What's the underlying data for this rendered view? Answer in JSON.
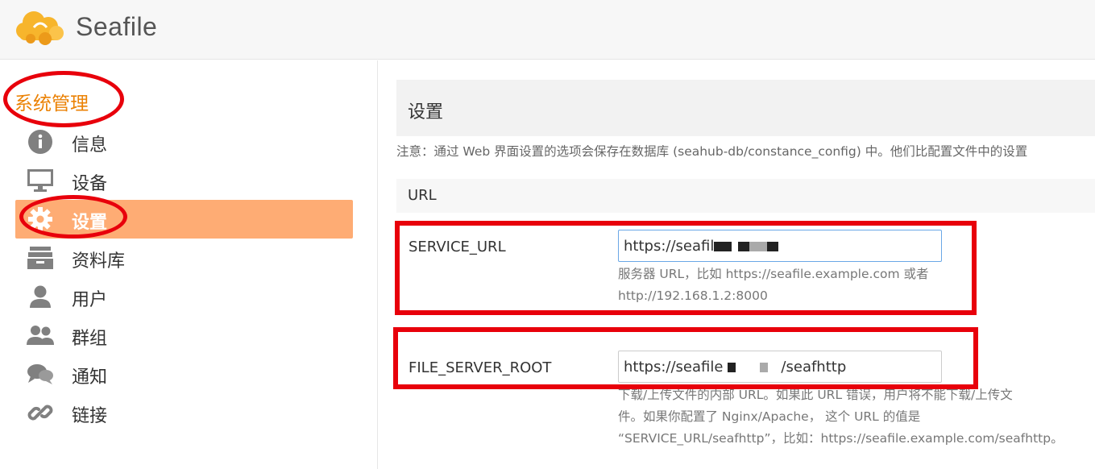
{
  "app": {
    "name": "Seafile"
  },
  "sidebar": {
    "title": "系统管理",
    "items": [
      {
        "label": "信息",
        "icon": "info-icon"
      },
      {
        "label": "设备",
        "icon": "monitor-icon"
      },
      {
        "label": "设置",
        "icon": "gear-icon",
        "active": true
      },
      {
        "label": "资料库",
        "icon": "library-icon"
      },
      {
        "label": "用户",
        "icon": "user-icon"
      },
      {
        "label": "群组",
        "icon": "group-icon"
      },
      {
        "label": "通知",
        "icon": "chat-icon"
      },
      {
        "label": "链接",
        "icon": "link-icon"
      }
    ]
  },
  "main": {
    "title": "设置",
    "notice": "注意：通过 Web 界面设置的选项会保存在数据库 (seahub-db/constance_config) 中。他们比配置文件中的设置",
    "section": "URL",
    "fields": [
      {
        "name": "SERVICE_URL",
        "value_prefix": "https://seafil",
        "help": "服务器 URL，比如 https://seafile.example.com 或者 http://192.168.1.2:8000"
      },
      {
        "name": "FILE_SERVER_ROOT",
        "value_prefix": "https://seafile",
        "value_suffix": "/seafhttp",
        "help_line1": "下载/上传文件的内部 URL。如果此 URL 错误，用户将不能下载/上传文",
        "help_line2": "件。如果你配置了 Nginx/Apache， 这个 URL 的值是",
        "help_line3": "“SERVICE_URL/seafhttp”，比如：https://seafile.example.com/seafhttp。"
      }
    ]
  },
  "colors": {
    "accent": "#eb8205",
    "active_bg": "#feac74",
    "annotation": "#e8000b"
  }
}
